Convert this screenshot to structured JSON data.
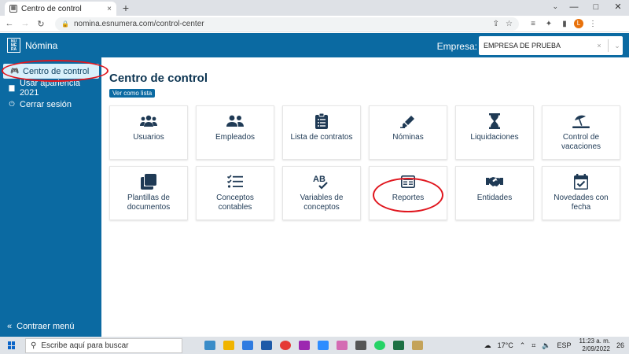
{
  "browser": {
    "tab_title": "Centro de control",
    "tab_close": "×",
    "new_tab": "+",
    "url": "nomina.esnumera.com/control-center",
    "window_controls": [
      "—",
      "□",
      "✕"
    ],
    "tab_menu": "⌄"
  },
  "app": {
    "logo_text": "NU ME RA",
    "name": "Nómina",
    "empresa_label": "Empresa:",
    "empresa_value": "EMPRESA DE PRUEBA",
    "empresa_clear": "×",
    "empresa_caret": "⌄"
  },
  "sidebar": {
    "items": [
      {
        "label": "Centro de control",
        "icon": "gamepad-icon",
        "glyph": "🎮"
      },
      {
        "label": "Usar apariencia 2021",
        "icon": "toggle-icon",
        "glyph": "▆"
      },
      {
        "label": "Cerrar sesión",
        "icon": "power-icon",
        "glyph": "⏻"
      }
    ],
    "collapse_label": "Contraer menú",
    "collapse_glyph": "«"
  },
  "main": {
    "title": "Centro de control",
    "list_button": "Ver como lista",
    "cards": [
      {
        "label": "Usuarios",
        "icon": "users-icon"
      },
      {
        "label": "Empleados",
        "icon": "user-group-icon"
      },
      {
        "label": "Lista de contratos",
        "icon": "clipboard-list-icon"
      },
      {
        "label": "Nóminas",
        "icon": "highlighter-icon"
      },
      {
        "label": "Liquidaciones",
        "icon": "hourglass-icon"
      },
      {
        "label": "Control de vacaciones",
        "icon": "umbrella-beach-icon"
      },
      {
        "label": "Plantillas de documentos",
        "icon": "clone-icon"
      },
      {
        "label": "Conceptos contables",
        "icon": "tasks-icon"
      },
      {
        "label": "Variables de conceptos",
        "icon": "spell-check-icon"
      },
      {
        "label": "Reportes",
        "icon": "newspaper-icon"
      },
      {
        "label": "Entidades",
        "icon": "handshake-icon"
      },
      {
        "label": "Novedades con fecha",
        "icon": "calendar-check-icon"
      }
    ]
  },
  "taskbar": {
    "search_placeholder": "Escribe aquí para buscar",
    "temperature": "17°C",
    "language": "ESP",
    "time": "11:23 a. m.",
    "date": "2/09/2022",
    "notifications": "26"
  },
  "colors": {
    "brand": "#0b6aa2",
    "annotation": "#e0161e"
  }
}
